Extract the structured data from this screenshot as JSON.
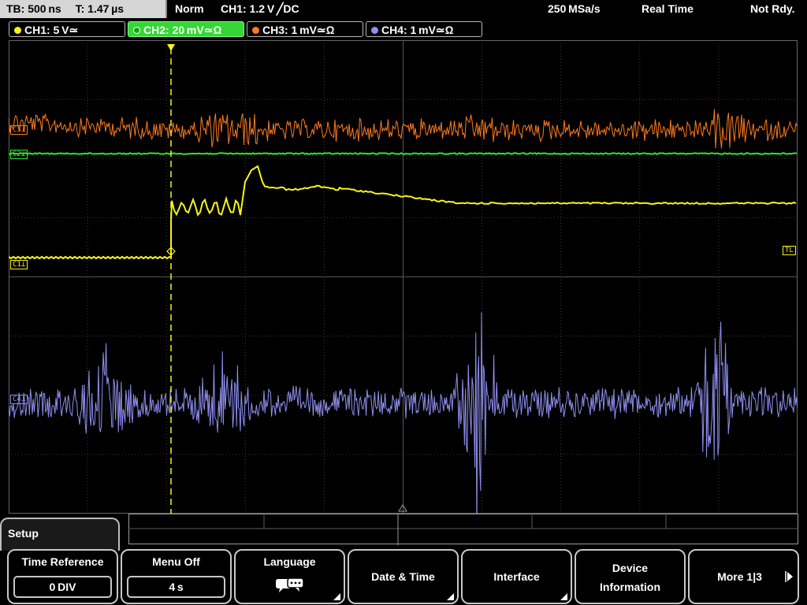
{
  "statusbar": {
    "timebase": "TB: 500 ns",
    "trigger_time": "T: 1.47 µs",
    "trigger_mode": "Norm",
    "trigger_info": "CH1: 1.2 V ╱DC",
    "sample_rate": "250 MSa/s",
    "acq_mode": "Real Time",
    "run_state": "Not Rdy."
  },
  "channels": [
    {
      "label": "CH1: 5 V≃",
      "color": "#f5f519",
      "active": false
    },
    {
      "label": "CH2: 20 mV≃Ω",
      "color": "#2ee62e",
      "active": true
    },
    {
      "label": "CH3: 1 mV≃Ω",
      "color": "#ff7a1e",
      "active": false
    },
    {
      "label": "CH4: 1 mV≃Ω",
      "color": "#8f8ff0",
      "active": false
    }
  ],
  "markers": {
    "c3": "C3⊥",
    "c2": "C2⊥",
    "c1": "C1⊥",
    "c4": "C4⊥",
    "tl": "TL",
    "trig": "T"
  },
  "bottom_tab": {
    "label": "Setup"
  },
  "softkeys": [
    {
      "label": "Time Reference",
      "value": "0 DIV"
    },
    {
      "label": "Menu Off",
      "value": "4 s"
    },
    {
      "label": "Language",
      "icon": "speech-bubbles-icon"
    },
    {
      "label": "Date & Time"
    },
    {
      "label": "Interface"
    },
    {
      "label": "Device",
      "label2": "Information"
    },
    {
      "label": "More 1|3",
      "icon": "arrow-right-icon"
    }
  ],
  "colors": {
    "ch1": "#f5f519",
    "ch2": "#2ee62e",
    "ch3": "#ff7a1e",
    "ch4": "#8f8ff0",
    "grid": "#3c3c3c",
    "softkey_border": "#c7c7c7"
  }
}
